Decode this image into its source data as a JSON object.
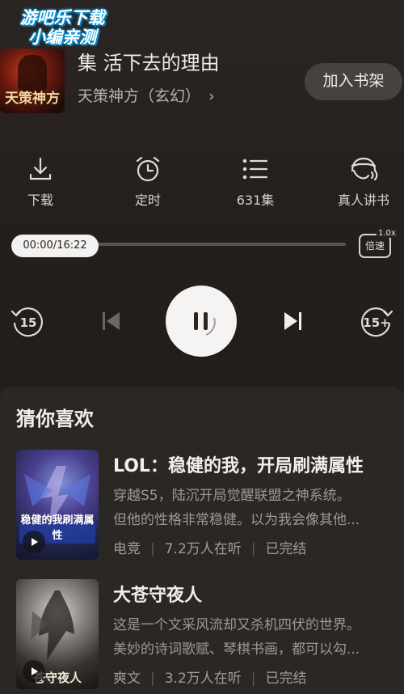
{
  "watermark": {
    "line1": "游吧乐下载",
    "line2": "小编亲测"
  },
  "now_playing": {
    "cover_text": "天策神方",
    "chapter_title": "集 活下去的理由",
    "book_name": "天策神方（玄幻）",
    "chevron": "›",
    "add_to_shelf": "加入书架"
  },
  "features": [
    {
      "label": "下载",
      "icon": "download-icon"
    },
    {
      "label": "定时",
      "icon": "alarm-clock-icon"
    },
    {
      "label": "631集",
      "icon": "list-icon"
    },
    {
      "label": "真人讲书",
      "icon": "headphones-icon"
    }
  ],
  "player": {
    "time": "00:00/16:22",
    "progress": 0.0,
    "speed_label": "倍速",
    "speed_value": "1.0x",
    "rewind_label": "15",
    "forward_label": "15+"
  },
  "recommend": {
    "title": "猜你喜欢",
    "items": [
      {
        "name": "LOL：稳健的我，开局刷满属性",
        "desc_line1": "穿越S5，陆沉开局觉醒联盟之神系统。",
        "desc_line2": "但他的性格非常稳健。以为我会像其他...",
        "category": "电竞",
        "listeners": "7.2万人在听",
        "status": "已完结",
        "cover_caption": "稳健的我刷满属性"
      },
      {
        "name": "大苍守夜人",
        "desc_line1": "这是一个文采风流却又杀机四伏的世界。",
        "desc_line2": "美妙的诗词歌赋、琴棋书画，都可以勾...",
        "category": "爽文",
        "listeners": "3.2万人在听",
        "status": "已完结",
        "cover_caption": "苍守夜人"
      }
    ]
  }
}
